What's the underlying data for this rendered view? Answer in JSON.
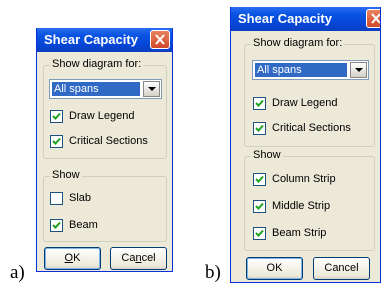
{
  "captions": {
    "a": "a)",
    "b": "b)"
  },
  "dialog_a": {
    "title": "Shear Capacity",
    "show_diagram_label": "Show diagram for:",
    "diagram_selected": "All spans",
    "draw_legend": {
      "label": "Draw Legend",
      "checked": true
    },
    "critical_sections": {
      "label": "Critical Sections",
      "checked": true
    },
    "show_label": "Show",
    "slab": {
      "label": "Slab",
      "checked": false
    },
    "beam": {
      "label": "Beam",
      "checked": true
    },
    "ok_label": "OK",
    "ok_accel": "O",
    "ok_rest": "K",
    "cancel_label": "Cancel",
    "cancel_pre": "Ca",
    "cancel_accel": "n",
    "cancel_post": "cel"
  },
  "dialog_b": {
    "title": "Shear Capacity",
    "show_diagram_label": "Show diagram for:",
    "diagram_selected": "All spans",
    "draw_legend": {
      "label": "Draw Legend",
      "checked": true
    },
    "critical_sections": {
      "label": "Critical Sections",
      "checked": true
    },
    "show_label": "Show",
    "column_strip": {
      "label": "Column Strip",
      "checked": true
    },
    "middle_strip": {
      "label": "Middle Strip",
      "checked": true
    },
    "beam_strip": {
      "label": "Beam Strip",
      "checked": true
    },
    "ok_label": "OK",
    "cancel_label": "Cancel"
  },
  "colors": {
    "titlebar": "#0a54e3",
    "dialog_bg": "#ece9d8",
    "selection": "#316ac5",
    "close_button": "#d85a37"
  }
}
